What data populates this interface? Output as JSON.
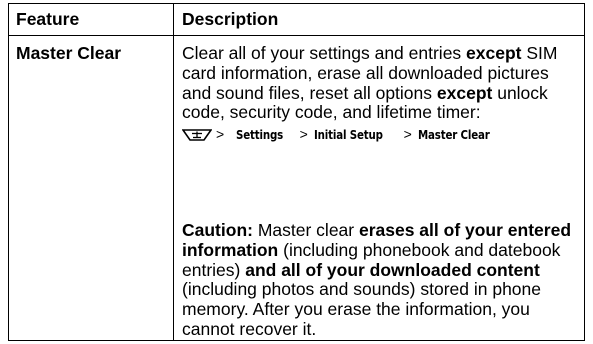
{
  "table": {
    "headers": [
      "Feature",
      "Description"
    ],
    "feature_name": "Master Clear",
    "para1": {
      "t1": "Clear all of your settings and entries ",
      "b1": "except",
      "t2": " SIM card information, erase all downloaded pictures and sound files, reset all options ",
      "b2": "except",
      "t3": " unlock code, security code, and lifetime timer:"
    },
    "path": {
      "sep": ">",
      "items": [
        "Settings",
        "Initial Setup",
        "Master Clear"
      ]
    },
    "para2": {
      "b1": "Caution:",
      "t1": " Master clear ",
      "b2": "erases all of your entered information",
      "t2": " (including phonebook and datebook entries) ",
      "b3": "and all of your downloaded content",
      "t3": " (including photos and sounds) stored in phone memory. After you erase the information, you cannot recover it."
    }
  },
  "icons": {
    "menu_key": "menu-key-icon"
  }
}
